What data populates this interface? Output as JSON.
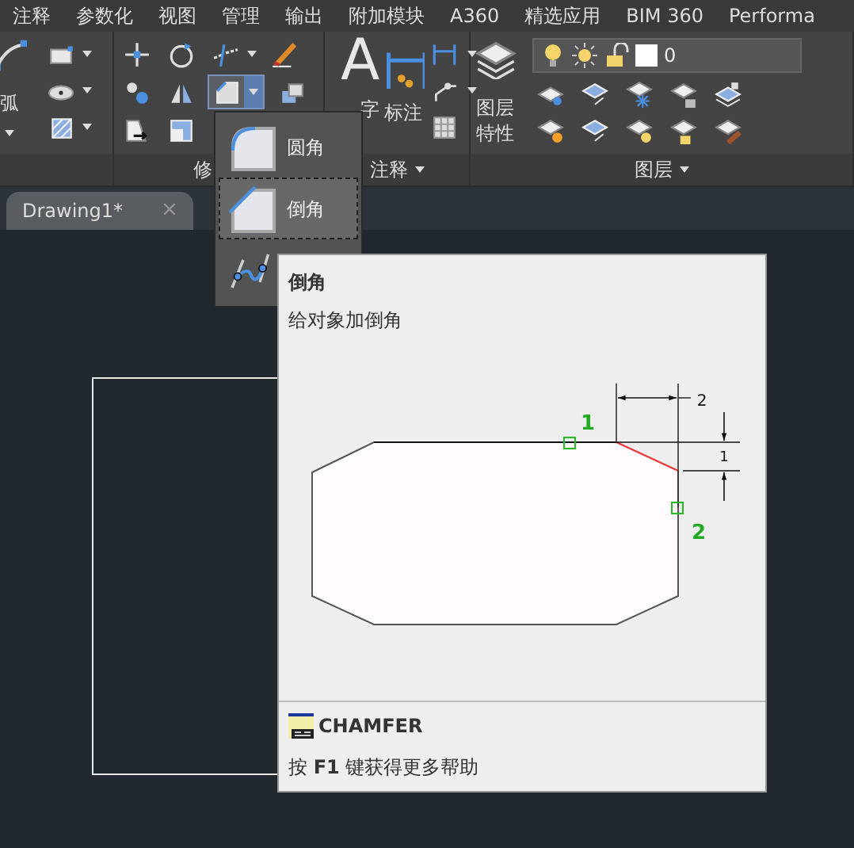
{
  "menu_tabs": [
    "注释",
    "参数化",
    "视图",
    "管理",
    "输出",
    "附加模块",
    "A360",
    "精选应用",
    "BIM 360",
    "Performa"
  ],
  "ribbon": {
    "draw": {
      "big_button": "弧"
    },
    "modify": {
      "title": "修"
    },
    "annotation": {
      "title": "注释",
      "text_button": {
        "icon": "A",
        "label": "字"
      },
      "dimension_button": "标注"
    },
    "layers": {
      "title": "图层",
      "properties_button": "图层特性",
      "layer_combo": {
        "value": "0"
      }
    }
  },
  "modify_dropdown": {
    "items": [
      {
        "kind": "fillet",
        "label": "圆角",
        "selected": false
      },
      {
        "kind": "chamfer",
        "label": "倒角",
        "selected": true
      },
      {
        "kind": "blend",
        "selected": false
      }
    ]
  },
  "document_tabs": [
    {
      "label": "Drawing1*",
      "selected": true,
      "close": "×"
    }
  ],
  "tooltip": {
    "title": "倒角",
    "description": "给对象加倒角",
    "diagram": {
      "pick_labels": [
        "1",
        "2"
      ],
      "distance_labels": [
        "2",
        "1"
      ]
    },
    "command": "CHAMFER",
    "help": "按 **F1** 键获得更多帮助"
  }
}
